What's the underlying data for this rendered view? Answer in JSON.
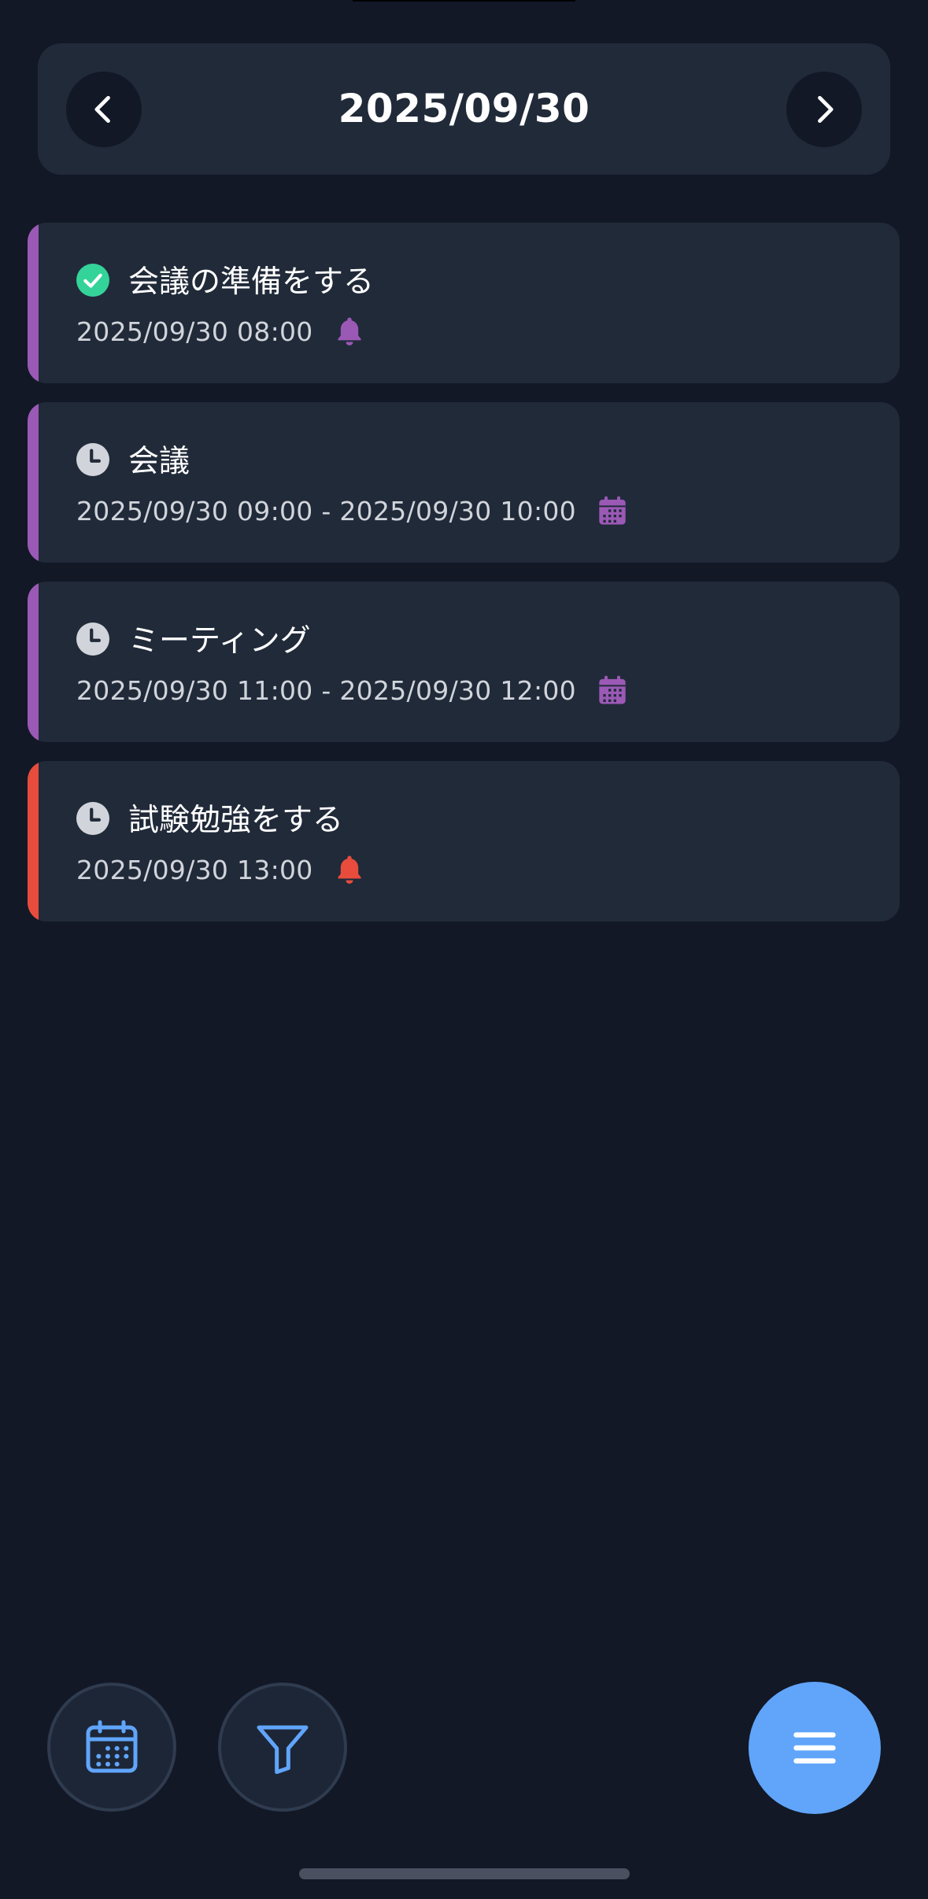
{
  "header": {
    "date": "2025/09/30",
    "prev_icon": "chevron-left-icon",
    "next_icon": "chevron-right-icon"
  },
  "tasks": [
    {
      "title": "会議の準備をする",
      "time": "2025/09/30 08:00",
      "status": "completed",
      "status_icon": "check-circle-icon",
      "type_icon": "bell-icon",
      "accent_color": "#9b59b6",
      "status_color": "#34d399"
    },
    {
      "title": "会議",
      "time": "2025/09/30 09:00 - 2025/09/30 10:00",
      "status": "pending",
      "status_icon": "clock-icon",
      "type_icon": "calendar-icon",
      "accent_color": "#9b59b6",
      "status_color": "#d1d5db"
    },
    {
      "title": "ミーティング",
      "time": "2025/09/30 11:00 - 2025/09/30 12:00",
      "status": "pending",
      "status_icon": "clock-icon",
      "type_icon": "calendar-icon",
      "accent_color": "#9b59b6",
      "status_color": "#d1d5db"
    },
    {
      "title": "試験勉強をする",
      "time": "2025/09/30 13:00",
      "status": "pending",
      "status_icon": "clock-icon",
      "type_icon": "bell-icon",
      "accent_color": "#e74c3c",
      "status_color": "#d1d5db"
    }
  ],
  "toolbar": {
    "calendar_icon": "calendar-icon",
    "filter_icon": "filter-icon",
    "menu_icon": "menu-icon"
  },
  "colors": {
    "background": "#121826",
    "card": "#212a39",
    "accent_blue": "#60a5fa",
    "purple": "#9b59b6",
    "red": "#e74c3c",
    "green": "#34d399"
  }
}
